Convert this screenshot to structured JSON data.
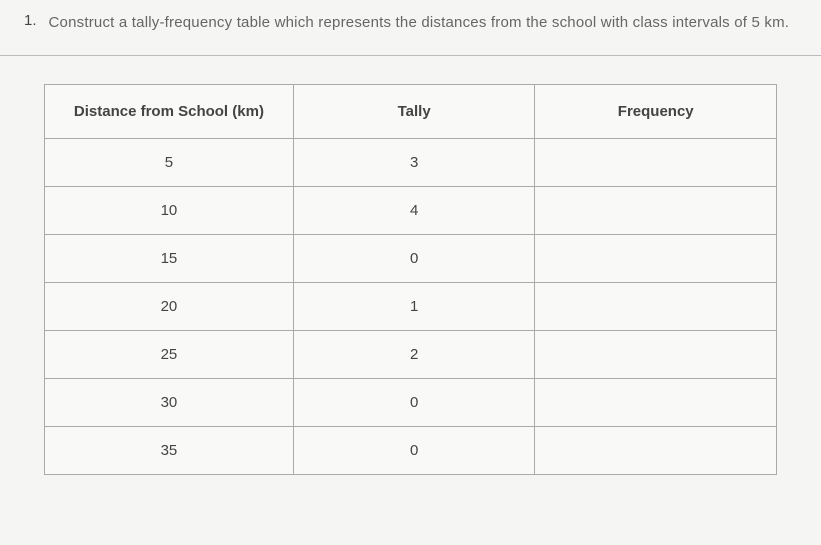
{
  "question": {
    "number": "1.",
    "text": "Construct a tally-frequency table which represents the distances from the school with class intervals of 5 km."
  },
  "table": {
    "headers": [
      "Distance from School (km)",
      "Tally",
      "Frequency"
    ],
    "rows": [
      {
        "distance": "5",
        "tally": "3",
        "frequency": ""
      },
      {
        "distance": "10",
        "tally": "4",
        "frequency": ""
      },
      {
        "distance": "15",
        "tally": "0",
        "frequency": ""
      },
      {
        "distance": "20",
        "tally": "1",
        "frequency": ""
      },
      {
        "distance": "25",
        "tally": "2",
        "frequency": ""
      },
      {
        "distance": "30",
        "tally": "0",
        "frequency": ""
      },
      {
        "distance": "35",
        "tally": "0",
        "frequency": ""
      }
    ]
  }
}
